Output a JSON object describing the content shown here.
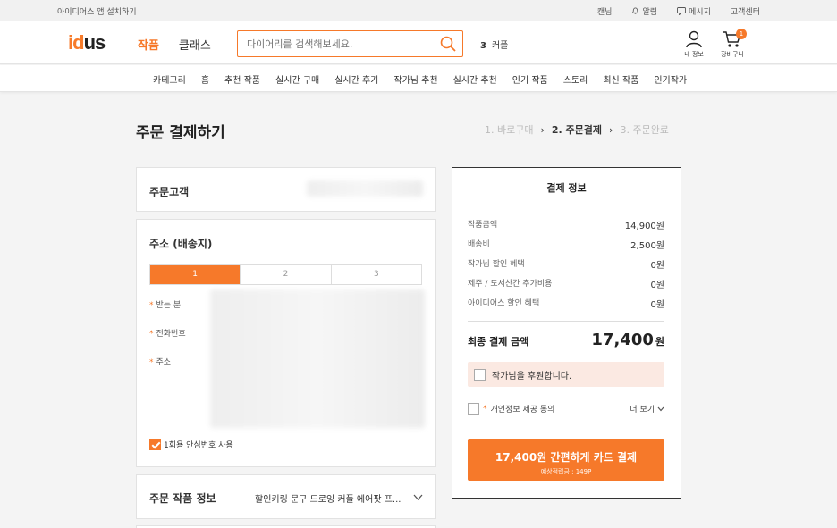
{
  "topbar": {
    "install_app": "아이디어스 앱 설치하기",
    "links": [
      "캔님",
      "알림",
      "메시지",
      "고객센터"
    ]
  },
  "header": {
    "logo_left": "id",
    "logo_right": "us",
    "nav": [
      "작품",
      "클래스"
    ],
    "search_placeholder": "다이어리를 검색해보세요.",
    "trend_rank": "3",
    "trend_term": "커플",
    "my_info_label": "내 정보",
    "cart_label": "장바구니",
    "cart_count": "1"
  },
  "categories": [
    "카테고리",
    "홈",
    "추천 작품",
    "실시간 구매",
    "실시간 후기",
    "작가님 추천",
    "실시간 추천",
    "인기 작품",
    "스토리",
    "최신 작품",
    "인기작가"
  ],
  "page": {
    "title": "주문 결제하기",
    "steps": [
      "1. 바로구매",
      "2. 주문결제",
      "3. 주문완료"
    ]
  },
  "customer": {
    "label": "주문고객"
  },
  "address": {
    "label": "주소 (배송지)",
    "tabs": [
      "1",
      "2",
      "3"
    ],
    "fields": [
      "받는 분",
      "전화번호",
      "주소"
    ],
    "safe_number": "1회용 안심번호 사용"
  },
  "order_info": {
    "label": "주문 작품 정보",
    "product": "할인키링 문구 드로잉 커플 에어팟 프..."
  },
  "payment": {
    "title": "결제 정보",
    "rows": [
      {
        "k": "작품금액",
        "v": "14,900원"
      },
      {
        "k": "배송비",
        "v": "2,500원"
      },
      {
        "k": "작가님 할인 혜택",
        "v": "0원"
      },
      {
        "k": "제주 / 도서산간 추가비용",
        "v": "0원"
      },
      {
        "k": "아이디어스 할인 혜택",
        "v": "0원"
      }
    ],
    "total_label": "최종 결제 금액",
    "total_value": "17,400",
    "total_unit": "원",
    "support_text": "작가님을 후원합니다.",
    "privacy_required": "*",
    "privacy_text": "개인정보 제공 동의",
    "more": "더 보기",
    "pay_button": "17,400원 간편하게 카드 결제",
    "points": "예상적립금 : 149P"
  },
  "colors": {
    "accent": "#f6792a",
    "support_bg": "#fbe9e2"
  }
}
